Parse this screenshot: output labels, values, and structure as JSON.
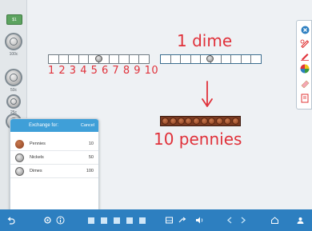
{
  "rail": {
    "bill_label": "$1",
    "coins": [
      {
        "name": "half-dollar",
        "label": "100c"
      },
      {
        "name": "quarter",
        "label": "50c"
      },
      {
        "name": "dime",
        "label": "25c"
      },
      {
        "name": "nickel",
        "label": ""
      }
    ]
  },
  "canvas": {
    "number_line_text": "1 2 3 4 5 6 7 8 9 10",
    "dime_text": "1  dime",
    "pennies_text": "10  pennies",
    "ink_color": "#e0313a"
  },
  "popup": {
    "title": "Exchange for:",
    "cancel": "Cancel",
    "rows": [
      {
        "coin": "penny",
        "name": "Pennies",
        "value": "10"
      },
      {
        "coin": "nickel",
        "name": "Nickels",
        "value": "50"
      },
      {
        "coin": "dime",
        "name": "Dimes",
        "value": "100"
      }
    ]
  },
  "palette": {
    "tools": [
      "close-icon",
      "pen-icon",
      "red-pen-icon",
      "color-wheel-icon",
      "eraser-icon",
      "note-icon"
    ]
  },
  "toolbar": {
    "icons": [
      "undo-icon",
      "settings-icon",
      "info-icon",
      "view-1-icon",
      "view-2-icon",
      "view-3-icon",
      "view-4-icon",
      "view-5-icon",
      "tray-icon",
      "share-icon",
      "sound-icon",
      "back-icon",
      "forward-icon",
      "home-icon",
      "account-icon"
    ]
  },
  "colors": {
    "toolbar_blue": "#2d7fc0",
    "popup_header_blue": "#3f9fd8",
    "penny_brown": "#7a3a22"
  }
}
